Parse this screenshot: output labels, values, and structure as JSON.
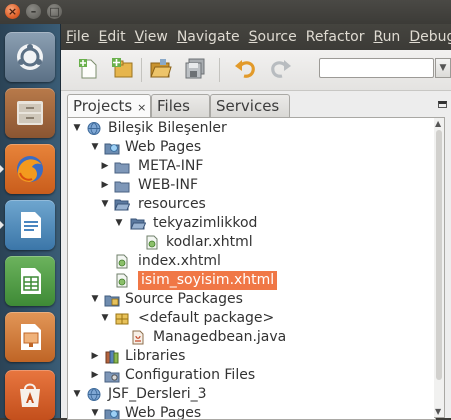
{
  "window_buttons": {
    "close": "×",
    "minimize": "–",
    "maximize": "□"
  },
  "launcher": {
    "items": [
      {
        "name": "dash-home"
      },
      {
        "name": "files"
      },
      {
        "name": "firefox"
      },
      {
        "name": "libreoffice-writer"
      },
      {
        "name": "libreoffice-calc"
      },
      {
        "name": "libreoffice-impress"
      },
      {
        "name": "software-center"
      }
    ]
  },
  "menubar": {
    "items": [
      {
        "mnemonic": "F",
        "rest": "ile"
      },
      {
        "mnemonic": "E",
        "rest": "dit"
      },
      {
        "mnemonic": "V",
        "rest": "iew"
      },
      {
        "mnemonic": "N",
        "rest": "avigate"
      },
      {
        "mnemonic": "S",
        "rest": "ource"
      },
      {
        "mnemonic": "R",
        "rest": "efactor",
        "prefix": "Re",
        "full": "Refactor"
      },
      {
        "mnemonic": "R",
        "rest": "un"
      },
      {
        "mnemonic": "D",
        "rest": "ebug"
      }
    ]
  },
  "toolbar": {
    "buttons": [
      "new-file-icon",
      "new-project-icon",
      "open-project-icon",
      "save-all-icon",
      "undo-icon",
      "redo-icon"
    ],
    "search_value": "",
    "search_drop": "▼"
  },
  "tabs": {
    "projects": "Projects",
    "projects_close": "×",
    "files": "Files",
    "services": "Services"
  },
  "tree": {
    "rows": [
      {
        "level": 0,
        "toggle": "▼",
        "icon": "globe-project-icon",
        "label": "Bileşik Bileşenler"
      },
      {
        "level": 1,
        "toggle": "▼",
        "icon": "web-pages-icon",
        "label": "Web Pages"
      },
      {
        "level": 2,
        "toggle": "▶",
        "icon": "folder-icon",
        "label": "META-INF"
      },
      {
        "level": 2,
        "toggle": "▶",
        "icon": "folder-icon",
        "label": "WEB-INF"
      },
      {
        "level": 2,
        "toggle": "▼",
        "icon": "folder-open-icon",
        "label": "resources"
      },
      {
        "level": 3,
        "toggle": "▼",
        "icon": "folder-open-icon",
        "label": "tekyazimlikkod"
      },
      {
        "level": 4,
        "toggle": "",
        "icon": "xhtml-file-icon",
        "label": "kodlar.xhtml"
      },
      {
        "level": 2,
        "toggle": "",
        "icon": "xhtml-file-icon",
        "label": "index.xhtml"
      },
      {
        "level": 2,
        "toggle": "",
        "icon": "xhtml-file-icon",
        "label": "isim_soyisim.xhtml",
        "selected": true
      },
      {
        "level": 1,
        "toggle": "▼",
        "icon": "source-packages-icon",
        "label": "Source Packages"
      },
      {
        "level": 2,
        "toggle": "▼",
        "icon": "package-icon",
        "label": "<default package>"
      },
      {
        "level": 3,
        "toggle": "",
        "icon": "java-file-icon",
        "label": "Managedbean.java"
      },
      {
        "level": 1,
        "toggle": "▶",
        "icon": "libraries-icon",
        "label": "Libraries"
      },
      {
        "level": 1,
        "toggle": "▶",
        "icon": "config-files-icon",
        "label": "Configuration Files"
      },
      {
        "level": 0,
        "toggle": "▼",
        "icon": "globe-project-icon",
        "label": "JSF_Dersleri_3"
      },
      {
        "level": 1,
        "toggle": "▼",
        "icon": "web-pages-icon",
        "label": "Web Pages"
      }
    ]
  },
  "scrollbar": {
    "up": "▲",
    "down": "▼"
  },
  "colors": {
    "selection": "#f07746",
    "panel": "#3c3b37",
    "launcher": "#315068"
  }
}
